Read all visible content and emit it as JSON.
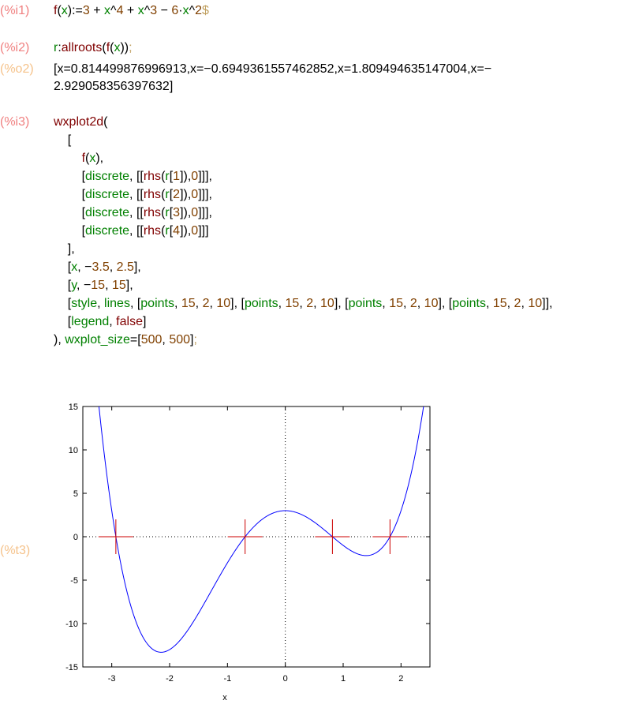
{
  "cells": [
    {
      "label": "(%i1)",
      "kind": "input"
    },
    {
      "label": "(%i2)",
      "kind": "input"
    },
    {
      "label": "(%o2)",
      "kind": "output"
    },
    {
      "label": "(%i3)",
      "kind": "input"
    },
    {
      "label": "(%t3)",
      "kind": "output"
    }
  ],
  "i1": {
    "code": [
      [
        "f",
        "fn"
      ],
      [
        "(",
        "op"
      ],
      [
        "x",
        "var"
      ],
      [
        "):=",
        "op"
      ],
      [
        "3",
        "num"
      ],
      [
        " + ",
        "op"
      ],
      [
        "x",
        "var"
      ],
      [
        "^",
        "op"
      ],
      [
        "4",
        "num"
      ],
      [
        " + ",
        "op"
      ],
      [
        "x",
        "var"
      ],
      [
        "^",
        "op"
      ],
      [
        "3",
        "num"
      ],
      [
        " − ",
        "op"
      ],
      [
        "6",
        "num"
      ],
      [
        "·",
        "op"
      ],
      [
        "x",
        "var"
      ],
      [
        "^",
        "op"
      ],
      [
        "2",
        "num"
      ],
      [
        "$",
        "sup"
      ]
    ]
  },
  "i2": {
    "code": [
      [
        "r",
        "var"
      ],
      [
        ":",
        "op"
      ],
      [
        "allroots",
        "fn"
      ],
      [
        "(",
        "op"
      ],
      [
        "f",
        "fn"
      ],
      [
        "(",
        "op"
      ],
      [
        "x",
        "var"
      ],
      [
        "))",
        "op"
      ],
      [
        ";",
        "sup"
      ]
    ]
  },
  "o2": {
    "line1": "[x=0.814499876996913,x=−0.6949361557462852,x=1.809494635147004,x=−",
    "line2": "2.929058356397632]"
  },
  "i3": {
    "lines": [
      [
        [
          "wxplot2d",
          "fn"
        ],
        [
          "(",
          "op"
        ]
      ],
      [
        [
          "    [",
          "op"
        ]
      ],
      [
        [
          "        ",
          "op"
        ],
        [
          "f",
          "fn"
        ],
        [
          "(",
          "op"
        ],
        [
          "x",
          "var"
        ],
        [
          "),",
          "op"
        ]
      ],
      [
        [
          "        [",
          "op"
        ],
        [
          "discrete",
          "var"
        ],
        [
          ", [[",
          "op"
        ],
        [
          "rhs",
          "fn"
        ],
        [
          "(",
          "op"
        ],
        [
          "r",
          "var"
        ],
        [
          "[",
          "op"
        ],
        [
          "1",
          "num"
        ],
        [
          "]),",
          "op"
        ],
        [
          "0",
          "num"
        ],
        [
          "]]],",
          "op"
        ]
      ],
      [
        [
          "        [",
          "op"
        ],
        [
          "discrete",
          "var"
        ],
        [
          ", [[",
          "op"
        ],
        [
          "rhs",
          "fn"
        ],
        [
          "(",
          "op"
        ],
        [
          "r",
          "var"
        ],
        [
          "[",
          "op"
        ],
        [
          "2",
          "num"
        ],
        [
          "]),",
          "op"
        ],
        [
          "0",
          "num"
        ],
        [
          "]]],",
          "op"
        ]
      ],
      [
        [
          "        [",
          "op"
        ],
        [
          "discrete",
          "var"
        ],
        [
          ", [[",
          "op"
        ],
        [
          "rhs",
          "fn"
        ],
        [
          "(",
          "op"
        ],
        [
          "r",
          "var"
        ],
        [
          "[",
          "op"
        ],
        [
          "3",
          "num"
        ],
        [
          "]),",
          "op"
        ],
        [
          "0",
          "num"
        ],
        [
          "]]],",
          "op"
        ]
      ],
      [
        [
          "        [",
          "op"
        ],
        [
          "discrete",
          "var"
        ],
        [
          ", [[",
          "op"
        ],
        [
          "rhs",
          "fn"
        ],
        [
          "(",
          "op"
        ],
        [
          "r",
          "var"
        ],
        [
          "[",
          "op"
        ],
        [
          "4",
          "num"
        ],
        [
          "]),",
          "op"
        ],
        [
          "0",
          "num"
        ],
        [
          "]]]",
          "op"
        ]
      ],
      [
        [
          "    ],",
          "op"
        ]
      ],
      [
        [
          "    [",
          "op"
        ],
        [
          "x",
          "var"
        ],
        [
          ", −",
          "op"
        ],
        [
          "3.5",
          "num"
        ],
        [
          ", ",
          "op"
        ],
        [
          "2.5",
          "num"
        ],
        [
          "],",
          "op"
        ]
      ],
      [
        [
          "    [",
          "op"
        ],
        [
          "y",
          "var"
        ],
        [
          ", −",
          "op"
        ],
        [
          "15",
          "num"
        ],
        [
          ", ",
          "op"
        ],
        [
          "15",
          "num"
        ],
        [
          "],",
          "op"
        ]
      ],
      [
        [
          "    [",
          "op"
        ],
        [
          "style",
          "var"
        ],
        [
          ", ",
          "op"
        ],
        [
          "lines",
          "var"
        ],
        [
          ", [",
          "op"
        ],
        [
          "points",
          "var"
        ],
        [
          ", ",
          "op"
        ],
        [
          "15",
          "num"
        ],
        [
          ", ",
          "op"
        ],
        [
          "2",
          "num"
        ],
        [
          ", ",
          "op"
        ],
        [
          "10",
          "num"
        ],
        [
          "], [",
          "op"
        ],
        [
          "points",
          "var"
        ],
        [
          ", ",
          "op"
        ],
        [
          "15",
          "num"
        ],
        [
          ", ",
          "op"
        ],
        [
          "2",
          "num"
        ],
        [
          ", ",
          "op"
        ],
        [
          "10",
          "num"
        ],
        [
          "], [",
          "op"
        ],
        [
          "points",
          "var"
        ],
        [
          ", ",
          "op"
        ],
        [
          "15",
          "num"
        ],
        [
          ", ",
          "op"
        ],
        [
          "2",
          "num"
        ],
        [
          ", ",
          "op"
        ],
        [
          "10",
          "num"
        ],
        [
          "], [",
          "op"
        ],
        [
          "points",
          "var"
        ],
        [
          ", ",
          "op"
        ],
        [
          "15",
          "num"
        ],
        [
          ", ",
          "op"
        ],
        [
          "2",
          "num"
        ],
        [
          ", ",
          "op"
        ],
        [
          "10",
          "num"
        ],
        [
          "]],",
          "op"
        ]
      ],
      [
        [
          "    [",
          "op"
        ],
        [
          "legend",
          "var"
        ],
        [
          ", ",
          "op"
        ],
        [
          "false",
          "fn"
        ],
        [
          "]",
          "op"
        ]
      ],
      [
        [
          "), ",
          "op"
        ],
        [
          "wxplot_size",
          "var"
        ],
        [
          "=[",
          "op"
        ],
        [
          "500",
          "num"
        ],
        [
          ", ",
          "op"
        ],
        [
          "500",
          "num"
        ],
        [
          "]",
          "op"
        ],
        [
          ";",
          "sup"
        ]
      ]
    ]
  },
  "chart_data": {
    "type": "line",
    "function": "3 + x^4 + x^3 - 6*x^2",
    "xlabel": "x",
    "ylabel": "",
    "xlim": [
      -3.5,
      2.5
    ],
    "ylim": [
      -15,
      15
    ],
    "xticks": [
      "-3",
      "-2",
      "-1",
      "0",
      "1",
      "2"
    ],
    "xtick_values": [
      -3,
      -2,
      -1,
      0,
      1,
      2
    ],
    "yticks": [
      "15",
      "10",
      "5",
      "0",
      "-5",
      "-10",
      "-15"
    ],
    "ytick_values": [
      15,
      10,
      5,
      0,
      -5,
      -10,
      -15
    ],
    "curve_color": "#0000ff",
    "marker_color": "#cc0000",
    "roots": [
      -2.929058356397632,
      -0.6949361557462852,
      0.814499876996913,
      1.809494635147004
    ],
    "zero_axes_dotted": true
  }
}
